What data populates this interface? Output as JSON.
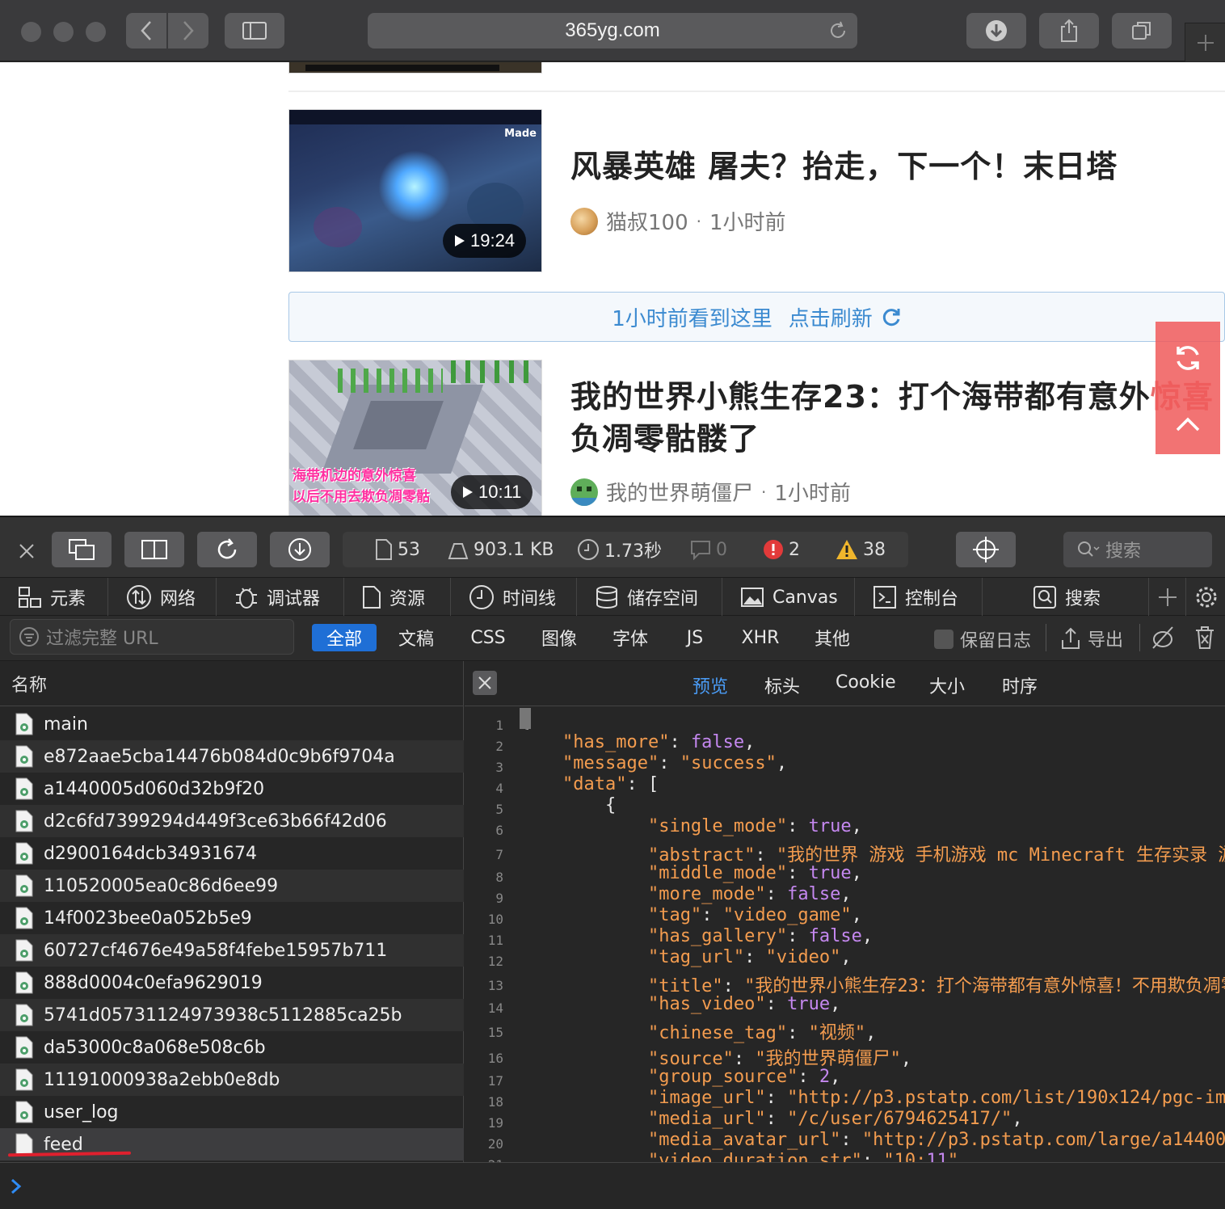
{
  "browser": {
    "url": "365yg.com"
  },
  "page": {
    "articles": [
      {
        "title": "风暴英雄 屠夫？抬走，下一个！末日塔",
        "author": "猫叔100",
        "time": "1小时前",
        "duration": "19:24",
        "thumb_text": "Made"
      },
      {
        "title_line1": "我的世界小熊生存23：打个海带都有意外",
        "title_line1_overlap": "惊喜",
        "title_line2": "负凋零骷髅了",
        "author": "我的世界萌僵尸",
        "time": "1小时前",
        "duration": "10:11",
        "thumb_caption1": "海带机边的意外惊喜",
        "thumb_caption2": "以后不用去欺负凋零骷"
      }
    ],
    "refresh_bar": {
      "text": "1小时前看到这里",
      "action": "点击刷新"
    },
    "dot": "·"
  },
  "devtools": {
    "stats": {
      "resources": "53",
      "size": "903.1 KB",
      "time": "1.73秒",
      "messages": "0",
      "errors": "2",
      "warnings": "38"
    },
    "search_placeholder": "搜索",
    "tabs": [
      "元素",
      "网络",
      "调试器",
      "资源",
      "时间线",
      "储存空间",
      "Canvas",
      "控制台",
      "搜索"
    ],
    "filter_placeholder": "过滤完整 URL",
    "filter_types": [
      "全部",
      "文稿",
      "CSS",
      "图像",
      "字体",
      "JS",
      "XHR",
      "其他"
    ],
    "preserve_log": "保留日志",
    "export": "导出",
    "name_header": "名称",
    "requests": [
      "main",
      "e872aae5cba14476b084d0c9b6f9704a",
      "a1440005d060d32b9f20",
      "d2c6fd7399294d449f3ce63b66f42d06",
      "d2900164dcb34931674",
      "110520005ea0c86d6ee99",
      "14f0023bee0a052b5e9",
      "60727cf4676e49a58f4febe15957b711",
      "888d0004c0efa9629019",
      "5741d05731124973938c5112885ca25b",
      "da53000c8a068e508c6b",
      "11191000938a2ebb0e8db",
      "user_log",
      "feed"
    ],
    "detail_tabs": [
      "预览",
      "标头",
      "Cookie",
      "大小",
      "时序"
    ],
    "code_lines": [
      {
        "n": "1",
        "text": "{"
      },
      {
        "n": "2",
        "text": "    \"has_more\": false,"
      },
      {
        "n": "3",
        "text": "    \"message\": \"success\","
      },
      {
        "n": "4",
        "text": "    \"data\": ["
      },
      {
        "n": "5",
        "text": "        {"
      },
      {
        "n": "6",
        "text": "            \"single_mode\": true,"
      },
      {
        "n": "7",
        "text": "            \"abstract\": \"我的世界 游戏 手机游戏 mc Minecraft 生存实录 游"
      },
      {
        "n": "8",
        "text": "            \"middle_mode\": true,"
      },
      {
        "n": "9",
        "text": "            \"more_mode\": false,"
      },
      {
        "n": "10",
        "text": "            \"tag\": \"video_game\","
      },
      {
        "n": "11",
        "text": "            \"has_gallery\": false,"
      },
      {
        "n": "12",
        "text": "            \"tag_url\": \"video\","
      },
      {
        "n": "13",
        "text": "            \"title\": \"我的世界小熊生存23：打个海带都有意外惊喜！不用欺负凋零"
      },
      {
        "n": "14",
        "text": "            \"has_video\": true,"
      },
      {
        "n": "15",
        "text": "            \"chinese_tag\": \"视频\","
      },
      {
        "n": "16",
        "text": "            \"source\": \"我的世界萌僵尸\","
      },
      {
        "n": "17",
        "text": "            \"group_source\": 2,"
      },
      {
        "n": "18",
        "text": "            \"image_url\": \"http://p3.pstatp.com/list/190x124/pgc-im"
      },
      {
        "n": "19",
        "text": "            \"media_url\": \"/c/user/6794625417/\","
      },
      {
        "n": "20",
        "text": "            \"media_avatar_url\": \"http://p3.pstatp.com/large/a14400"
      },
      {
        "n": "21",
        "text": "            \"video_duration_str\": \"10:11\","
      }
    ]
  }
}
